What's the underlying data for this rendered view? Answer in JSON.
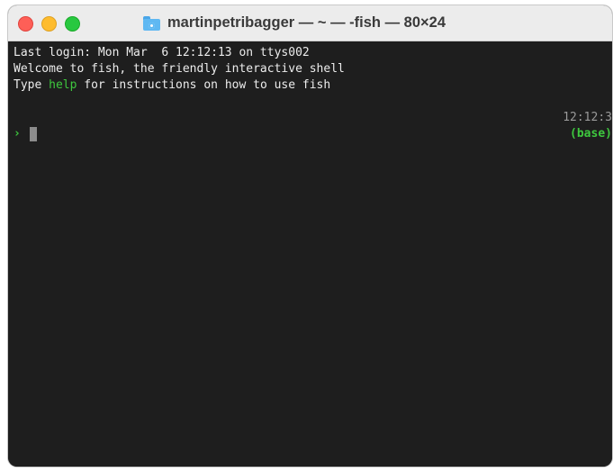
{
  "window": {
    "title": "martinpetribagger — ~ — -fish — 80×24",
    "folder_icon": "folder-icon"
  },
  "terminal": {
    "line1": "Last login: Mon Mar  6 12:12:13 on ttys002",
    "line2": "Welcome to fish, the friendly interactive shell",
    "line3_prefix": "Type ",
    "line3_help": "help",
    "line3_suffix": " for instructions on how to use fish",
    "prompt_dir": "~",
    "prompt_dots": " ...............................................................................",
    "prompt_time": "12:12:3",
    "prompt_char": "›",
    "prompt_env": "(base)"
  },
  "colors": {
    "background": "#1e1e1e",
    "text": "#ececec",
    "green": "#3ec83e",
    "cyan": "#4fb6d8"
  }
}
